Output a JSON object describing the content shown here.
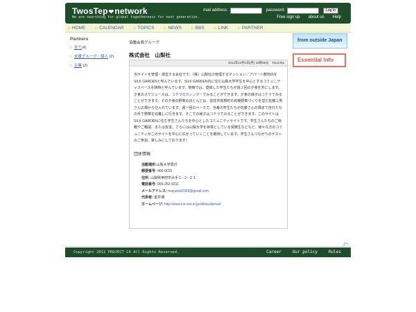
{
  "header": {
    "logo_left": "TwosTep",
    "logo_right": "network",
    "tagline": "We are searching for global togetherness for next generation.",
    "email_label": "mail address:",
    "password_label": "password:",
    "login_button": "Log In",
    "links": [
      "Free sign up",
      "about us",
      "Help"
    ]
  },
  "nav": [
    "HOME",
    "CALENDAR",
    "TOPICS",
    "NEWS",
    "BBS",
    "LINK",
    "PARTNER"
  ],
  "sidebar": {
    "title": "Partners",
    "items": [
      {
        "label": "全て",
        "count": "(4)"
      },
      {
        "label": "支援グループ・個人",
        "count": "(2)"
      },
      {
        "label": "企業",
        "count": "(2)"
      }
    ]
  },
  "main": {
    "breadcrumb": "協働会員グループ",
    "title": "株式会社　山梨社",
    "meta": "2012年10月1日(月) 18時35分　TwosTep",
    "desc": {
      "p1": "当サイトを管理・運営する会社です。（株）山梨社の管理するマンション／アパート敷地内をSILK GARDENと呼んでいます。SILK GARDEN内に住む山梨大学学生を中心とするコミュニティスペースを随時と呼んでいます。随時では、登録した学生たちが週３回の夕食を共にします。夕食のスケジュールは、",
      "kw1": "コチラのカレンダー",
      "p2": "でみることができます。夕食の様子は",
      "kw2": "コチラ",
      "p3": "でみることができます。その夕食の野菜のほとんどは、弦柱市高根町の有機野菜づくりを営む佐藤三男さんの畑から仕入れています。週一回のペースで、当番の学生たちが佐藤さんの畑まで自分たちの手で野菜を収穫しに行きます。そこでの様子は",
      "kw3": "コチラ",
      "p4": "でみることができます。このサイトはSILK GARDENに住む学生さんたちを中心としたコミュニティサイトです。学生さんたちのご両親やご親戚、または友達、さらには山梨大学を目標としている受験生などなど、様々な方のコミュニティがこのサイトを中心に広がっていくことを期待しています。学生さんつながりのゲストのご参加、楽しみにしております！"
    },
    "info_title": "団体情報",
    "info": {
      "area_label": "活動場所:",
      "area": "山梨大学周辺",
      "zip_label": "郵便番号:",
      "zip": "400-0015",
      "addr_label": "住所:",
      "addr": "山梨県甲府市大手１−２−２１",
      "tel_label": "電話番号:",
      "tel": "055-252-9211",
      "mail_label": "メールアドレス:",
      "mail": "mayutoki2009@gmail.com",
      "rep_label": "代表者:",
      "rep": "金井博",
      "hp_label": "ホームページ:",
      "hp": "http://www.lce-net.or.jp/silkresidence/"
    }
  },
  "banners": {
    "outside": "from outside Japan",
    "essential": "Essential Info"
  },
  "footer": {
    "totop": "上へ",
    "copyright": "Copyright  2011 PROJECT C4 All Rights Reserved.",
    "links": [
      "Career",
      "Our policy",
      "Rules"
    ]
  },
  "colors": {
    "header_bg": "#1f4d2b",
    "link": "#3a62a8",
    "nav_bg": "#f3f5d8",
    "arrow": "#d5a21d"
  }
}
